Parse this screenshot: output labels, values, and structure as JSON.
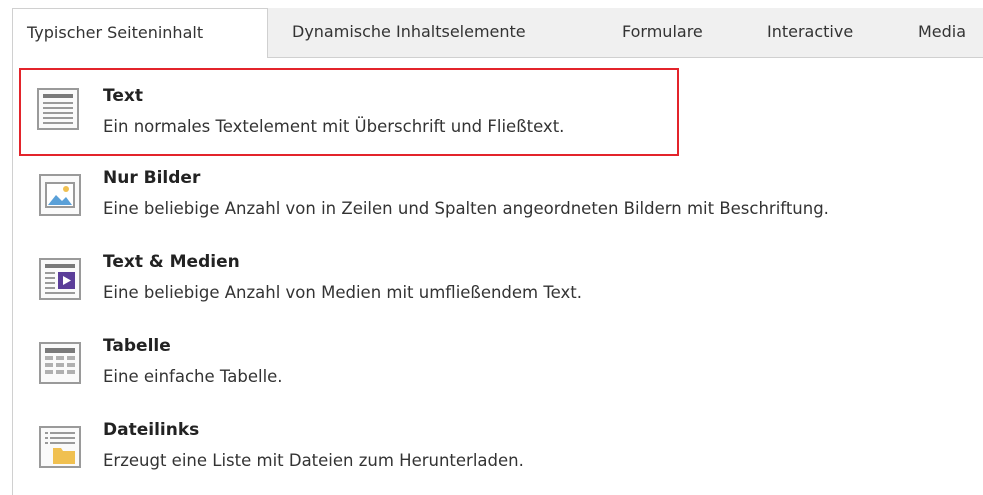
{
  "tabs": [
    {
      "label": "Typischer Seiteninhalt",
      "active": true
    },
    {
      "label": "Dynamische Inhaltselemente",
      "active": false
    },
    {
      "label": "Formulare",
      "active": false
    },
    {
      "label": "Interactive",
      "active": false
    },
    {
      "label": "Media",
      "active": false
    }
  ],
  "items": [
    {
      "title": "Text",
      "description": "Ein normales Textelement mit Überschrift und Fließtext.",
      "icon": "text-icon",
      "selected": true
    },
    {
      "title": "Nur Bilder",
      "description": "Eine beliebige Anzahl von in Zeilen und Spalten angeordneten Bildern mit Beschriftung.",
      "icon": "image-icon",
      "selected": false
    },
    {
      "title": "Text & Medien",
      "description": "Eine beliebige Anzahl von Medien mit umfließendem Text.",
      "icon": "text-media-icon",
      "selected": false
    },
    {
      "title": "Tabelle",
      "description": "Eine einfache Tabelle.",
      "icon": "table-icon",
      "selected": false
    },
    {
      "title": "Dateilinks",
      "description": "Erzeugt eine Liste mit Dateien zum Herunterladen.",
      "icon": "file-links-icon",
      "selected": false
    }
  ],
  "colors": {
    "selection_border": "#e3242b",
    "media_play": "#5b3d99",
    "image_sky": "#5aa0d8",
    "folder": "#f0c050"
  }
}
